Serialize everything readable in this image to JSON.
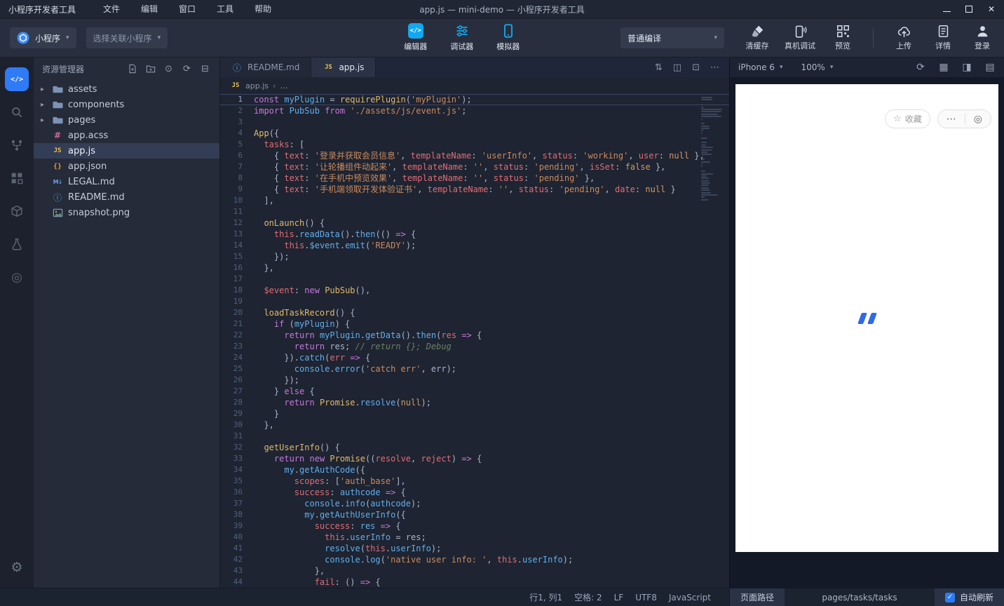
{
  "titlebar": {
    "app_name": "小程序开发者工具",
    "menus": [
      "文件",
      "编辑",
      "窗口",
      "工具",
      "帮助"
    ],
    "window_title": "app.js — mini-demo — 小程序开发者工具",
    "window_controls": [
      "minimize",
      "maximize",
      "close"
    ]
  },
  "toolbar": {
    "project_type": "小程序",
    "relate_label": "选择关联小程序",
    "views": [
      {
        "id": "editor",
        "label": "编辑器",
        "active": true
      },
      {
        "id": "debugger",
        "label": "调试器",
        "active": false
      },
      {
        "id": "simulator",
        "label": "模拟器",
        "active": true
      }
    ],
    "compile_mode": "普通编译",
    "actions": [
      {
        "id": "clear-cache",
        "label": "清缓存"
      },
      {
        "id": "real-device-debug",
        "label": "真机调试"
      },
      {
        "id": "preview",
        "label": "预览"
      }
    ],
    "actions2": [
      {
        "id": "upload",
        "label": "上传"
      },
      {
        "id": "details",
        "label": "详情"
      },
      {
        "id": "login",
        "label": "登录"
      }
    ]
  },
  "activitybar": {
    "items": [
      {
        "id": "code",
        "active": true
      },
      {
        "id": "search",
        "active": false
      },
      {
        "id": "git",
        "active": false
      },
      {
        "id": "plugins",
        "active": false
      },
      {
        "id": "package",
        "active": false
      },
      {
        "id": "flask",
        "active": false
      },
      {
        "id": "target",
        "active": false
      }
    ],
    "bottom": [
      {
        "id": "settings"
      }
    ]
  },
  "explorer": {
    "title": "资源管理器",
    "toolbar_icons": [
      "new-file",
      "new-folder",
      "locate",
      "refresh",
      "collapse-all"
    ],
    "items": [
      {
        "label": "assets",
        "type": "folder"
      },
      {
        "label": "components",
        "type": "folder"
      },
      {
        "label": "pages",
        "type": "folder"
      },
      {
        "label": "app.acss",
        "type": "acss"
      },
      {
        "label": "app.js",
        "type": "js",
        "selected": true
      },
      {
        "label": "app.json",
        "type": "json"
      },
      {
        "label": "LEGAL.md",
        "type": "md"
      },
      {
        "label": "README.md",
        "type": "readme"
      },
      {
        "label": "snapshot.png",
        "type": "image"
      }
    ]
  },
  "editor": {
    "tabs": [
      {
        "label": "README.md",
        "icon": "readme",
        "active": false
      },
      {
        "label": "app.js",
        "icon": "js",
        "active": true
      }
    ],
    "breadcrumb": {
      "file": "app.js",
      "more": "…"
    },
    "action_icons": [
      "sync-scroll",
      "split-editor",
      "open-preview",
      "more-actions"
    ],
    "code": [
      [
        [
          "k",
          "const"
        ],
        [
          "d",
          " "
        ],
        [
          "f",
          "myPlugin"
        ],
        [
          "d",
          " = "
        ],
        [
          "y",
          "requirePlugin"
        ],
        [
          "d",
          "("
        ],
        [
          "s",
          "'myPlugin'"
        ],
        [
          "d",
          ");"
        ]
      ],
      [
        [
          "k",
          "import"
        ],
        [
          "d",
          " "
        ],
        [
          "f",
          "PubSub"
        ],
        [
          "d",
          " "
        ],
        [
          "k",
          "from"
        ],
        [
          "d",
          " "
        ],
        [
          "s",
          "'./assets/js/event.js'"
        ],
        [
          "d",
          ";"
        ]
      ],
      [],
      [
        [
          "y",
          "App"
        ],
        [
          "d",
          "({"
        ]
      ],
      [
        [
          "d",
          "  "
        ],
        [
          "p",
          "tasks"
        ],
        [
          "d",
          ": ["
        ]
      ],
      [
        [
          "d",
          "    { "
        ],
        [
          "p",
          "text"
        ],
        [
          "d",
          ": "
        ],
        [
          "s",
          "'登录并获取会员信息'"
        ],
        [
          "d",
          ", "
        ],
        [
          "p",
          "templateName"
        ],
        [
          "d",
          ": "
        ],
        [
          "s",
          "'userInfo'"
        ],
        [
          "d",
          ", "
        ],
        [
          "p",
          "status"
        ],
        [
          "d",
          ": "
        ],
        [
          "s",
          "'working'"
        ],
        [
          "d",
          ", "
        ],
        [
          "p",
          "user"
        ],
        [
          "d",
          ": "
        ],
        [
          "n",
          "null"
        ],
        [
          "d",
          " },"
        ]
      ],
      [
        [
          "d",
          "    { "
        ],
        [
          "p",
          "text"
        ],
        [
          "d",
          ": "
        ],
        [
          "s",
          "'让轮播组件动起来'"
        ],
        [
          "d",
          ", "
        ],
        [
          "p",
          "templateName"
        ],
        [
          "d",
          ": "
        ],
        [
          "s",
          "''"
        ],
        [
          "d",
          ", "
        ],
        [
          "p",
          "status"
        ],
        [
          "d",
          ": "
        ],
        [
          "s",
          "'pending'"
        ],
        [
          "d",
          ", "
        ],
        [
          "p",
          "isSet"
        ],
        [
          "d",
          ": "
        ],
        [
          "n",
          "false"
        ],
        [
          "d",
          " },"
        ]
      ],
      [
        [
          "d",
          "    { "
        ],
        [
          "p",
          "text"
        ],
        [
          "d",
          ": "
        ],
        [
          "s",
          "'在手机中预览效果'"
        ],
        [
          "d",
          ", "
        ],
        [
          "p",
          "templateName"
        ],
        [
          "d",
          ": "
        ],
        [
          "s",
          "''"
        ],
        [
          "d",
          ", "
        ],
        [
          "p",
          "status"
        ],
        [
          "d",
          ": "
        ],
        [
          "s",
          "'pending'"
        ],
        [
          "d",
          " },"
        ]
      ],
      [
        [
          "d",
          "    { "
        ],
        [
          "p",
          "text"
        ],
        [
          "d",
          ": "
        ],
        [
          "s",
          "'手机端领取开发体验证书'"
        ],
        [
          "d",
          ", "
        ],
        [
          "p",
          "templateName"
        ],
        [
          "d",
          ": "
        ],
        [
          "s",
          "''"
        ],
        [
          "d",
          ", "
        ],
        [
          "p",
          "status"
        ],
        [
          "d",
          ": "
        ],
        [
          "s",
          "'pending'"
        ],
        [
          "d",
          ", "
        ],
        [
          "p",
          "date"
        ],
        [
          "d",
          ": "
        ],
        [
          "n",
          "null"
        ],
        [
          "d",
          " }"
        ]
      ],
      [
        [
          "d",
          "  ],"
        ]
      ],
      [],
      [
        [
          "d",
          "  "
        ],
        [
          "y",
          "onLaunch"
        ],
        [
          "d",
          "() {"
        ]
      ],
      [
        [
          "d",
          "    "
        ],
        [
          "p",
          "this"
        ],
        [
          "d",
          "."
        ],
        [
          "f",
          "readData"
        ],
        [
          "d",
          "()."
        ],
        [
          "f",
          "then"
        ],
        [
          "d",
          "(() "
        ],
        [
          "k",
          "=>"
        ],
        [
          "d",
          " {"
        ]
      ],
      [
        [
          "d",
          "      "
        ],
        [
          "p",
          "this"
        ],
        [
          "d",
          "."
        ],
        [
          "f",
          "$event"
        ],
        [
          "d",
          "."
        ],
        [
          "f",
          "emit"
        ],
        [
          "d",
          "("
        ],
        [
          "s",
          "'READY'"
        ],
        [
          "d",
          ");"
        ]
      ],
      [
        [
          "d",
          "    });"
        ]
      ],
      [
        [
          "d",
          "  },"
        ]
      ],
      [],
      [
        [
          "d",
          "  "
        ],
        [
          "p",
          "$event"
        ],
        [
          "d",
          ": "
        ],
        [
          "k",
          "new"
        ],
        [
          "d",
          " "
        ],
        [
          "y",
          "PubSub"
        ],
        [
          "d",
          "(),"
        ]
      ],
      [],
      [
        [
          "d",
          "  "
        ],
        [
          "y",
          "loadTaskRecord"
        ],
        [
          "d",
          "() {"
        ]
      ],
      [
        [
          "d",
          "    "
        ],
        [
          "k",
          "if"
        ],
        [
          "d",
          " ("
        ],
        [
          "f",
          "myPlugin"
        ],
        [
          "d",
          ") {"
        ]
      ],
      [
        [
          "d",
          "      "
        ],
        [
          "k",
          "return"
        ],
        [
          "d",
          " "
        ],
        [
          "f",
          "myPlugin"
        ],
        [
          "d",
          "."
        ],
        [
          "f",
          "getData"
        ],
        [
          "d",
          "()."
        ],
        [
          "f",
          "then"
        ],
        [
          "d",
          "("
        ],
        [
          "p",
          "res"
        ],
        [
          "d",
          " "
        ],
        [
          "k",
          "=>"
        ],
        [
          "d",
          " {"
        ]
      ],
      [
        [
          "d",
          "        "
        ],
        [
          "k",
          "return"
        ],
        [
          "d",
          " res; "
        ],
        [
          "c",
          "// return {}; Debug"
        ]
      ],
      [
        [
          "d",
          "      })."
        ],
        [
          "f",
          "catch"
        ],
        [
          "d",
          "("
        ],
        [
          "p",
          "err"
        ],
        [
          "d",
          " "
        ],
        [
          "k",
          "=>"
        ],
        [
          "d",
          " {"
        ]
      ],
      [
        [
          "d",
          "        "
        ],
        [
          "f",
          "console"
        ],
        [
          "d",
          "."
        ],
        [
          "f",
          "error"
        ],
        [
          "d",
          "("
        ],
        [
          "s",
          "'catch err'"
        ],
        [
          "d",
          ", err);"
        ]
      ],
      [
        [
          "d",
          "      });"
        ]
      ],
      [
        [
          "d",
          "    } "
        ],
        [
          "k",
          "else"
        ],
        [
          "d",
          " {"
        ]
      ],
      [
        [
          "d",
          "      "
        ],
        [
          "k",
          "return"
        ],
        [
          "d",
          " "
        ],
        [
          "y",
          "Promise"
        ],
        [
          "d",
          "."
        ],
        [
          "f",
          "resolve"
        ],
        [
          "d",
          "("
        ],
        [
          "n",
          "null"
        ],
        [
          "d",
          ");"
        ]
      ],
      [
        [
          "d",
          "    }"
        ]
      ],
      [
        [
          "d",
          "  },"
        ]
      ],
      [],
      [
        [
          "d",
          "  "
        ],
        [
          "y",
          "getUserInfo"
        ],
        [
          "d",
          "() {"
        ]
      ],
      [
        [
          "d",
          "    "
        ],
        [
          "k",
          "return"
        ],
        [
          "d",
          " "
        ],
        [
          "k",
          "new"
        ],
        [
          "d",
          " "
        ],
        [
          "y",
          "Promise"
        ],
        [
          "d",
          "(("
        ],
        [
          "p",
          "resolve"
        ],
        [
          "d",
          ", "
        ],
        [
          "p",
          "reject"
        ],
        [
          "d",
          ") "
        ],
        [
          "k",
          "=>"
        ],
        [
          "d",
          " {"
        ]
      ],
      [
        [
          "d",
          "      "
        ],
        [
          "f",
          "my"
        ],
        [
          "d",
          "."
        ],
        [
          "f",
          "getAuthCode"
        ],
        [
          "d",
          "({"
        ]
      ],
      [
        [
          "d",
          "        "
        ],
        [
          "p",
          "scopes"
        ],
        [
          "d",
          ": ["
        ],
        [
          "s",
          "'auth_base'"
        ],
        [
          "d",
          "],"
        ]
      ],
      [
        [
          "d",
          "        "
        ],
        [
          "p",
          "success"
        ],
        [
          "d",
          ": "
        ],
        [
          "f",
          "authcode"
        ],
        [
          "d",
          " "
        ],
        [
          "k",
          "=>"
        ],
        [
          "d",
          " {"
        ]
      ],
      [
        [
          "d",
          "          "
        ],
        [
          "f",
          "console"
        ],
        [
          "d",
          "."
        ],
        [
          "f",
          "info"
        ],
        [
          "d",
          "("
        ],
        [
          "f",
          "authcode"
        ],
        [
          "d",
          ");"
        ]
      ],
      [
        [
          "d",
          "          "
        ],
        [
          "f",
          "my"
        ],
        [
          "d",
          "."
        ],
        [
          "f",
          "getAuthUserInfo"
        ],
        [
          "d",
          "({"
        ]
      ],
      [
        [
          "d",
          "            "
        ],
        [
          "p",
          "success"
        ],
        [
          "d",
          ": "
        ],
        [
          "f",
          "res"
        ],
        [
          "d",
          " "
        ],
        [
          "k",
          "=>"
        ],
        [
          "d",
          " {"
        ]
      ],
      [
        [
          "d",
          "              "
        ],
        [
          "p",
          "this"
        ],
        [
          "d",
          "."
        ],
        [
          "f",
          "userInfo"
        ],
        [
          "d",
          " = res;"
        ]
      ],
      [
        [
          "d",
          "              "
        ],
        [
          "f",
          "resolve"
        ],
        [
          "d",
          "("
        ],
        [
          "p",
          "this"
        ],
        [
          "d",
          "."
        ],
        [
          "f",
          "userInfo"
        ],
        [
          "d",
          ");"
        ]
      ],
      [
        [
          "d",
          "              "
        ],
        [
          "f",
          "console"
        ],
        [
          "d",
          "."
        ],
        [
          "f",
          "log"
        ],
        [
          "d",
          "("
        ],
        [
          "s",
          "'native user info: '"
        ],
        [
          "d",
          ", "
        ],
        [
          "p",
          "this"
        ],
        [
          "d",
          "."
        ],
        [
          "f",
          "userInfo"
        ],
        [
          "d",
          ");"
        ]
      ],
      [
        [
          "d",
          "            },"
        ]
      ],
      [
        [
          "d",
          "            "
        ],
        [
          "p",
          "fail"
        ],
        [
          "d",
          ": () "
        ],
        [
          "k",
          "=>"
        ],
        [
          "d",
          " {"
        ]
      ]
    ]
  },
  "simulator": {
    "device": "iPhone 6",
    "zoom": "100%",
    "toolbar_icons": [
      "refresh",
      "grid",
      "screenshot",
      "panel"
    ],
    "capsule": {
      "favorite": "收藏"
    }
  },
  "statusbar": {
    "cursor": "行1, 列1",
    "indent": "空格: 2",
    "eol": "LF",
    "encoding": "UTF8",
    "language": "JavaScript",
    "path_label": "页面路径",
    "path_value": "pages/tasks/tasks",
    "auto_refresh_label": "自动刷新",
    "auto_refresh_checked": true
  },
  "colors": {
    "accent_blue": "#2f7bf6",
    "cyan_icon": "#13a7f0",
    "editor_bg": "#1e2431",
    "loading_mark": "#2e6be6"
  }
}
